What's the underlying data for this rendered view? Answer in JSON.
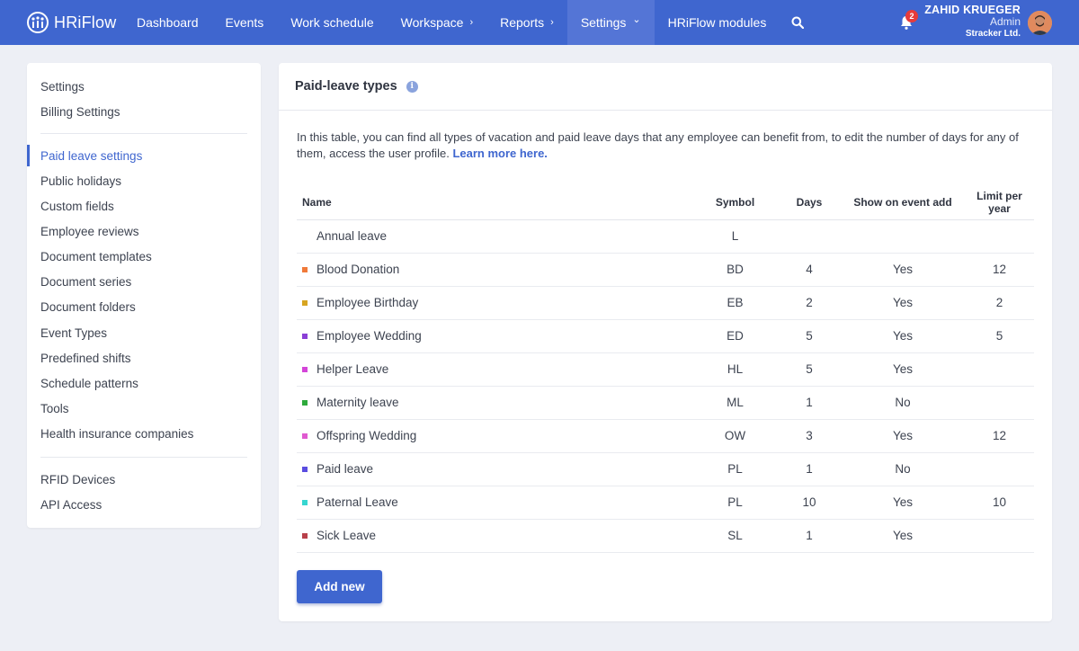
{
  "header": {
    "logo_text": "HRiFlow",
    "nav": [
      {
        "label": "Dashboard",
        "chevron": ""
      },
      {
        "label": "Events",
        "chevron": ""
      },
      {
        "label": "Work schedule",
        "chevron": ""
      },
      {
        "label": "Workspace",
        "chevron": "›"
      },
      {
        "label": "Reports",
        "chevron": "›"
      },
      {
        "label": "Settings",
        "chevron": "⌄"
      },
      {
        "label": "HRiFlow modules",
        "chevron": ""
      }
    ],
    "active_nav": "Settings",
    "notification_count": "2",
    "user": {
      "name": "ZAHID KRUEGER",
      "role": "Admin",
      "company": "Stracker Ltd."
    },
    "accent_color": "#3f66cf"
  },
  "sidebar": {
    "groups": [
      [
        "Settings",
        "Billing Settings"
      ],
      [
        "Paid leave settings",
        "Public holidays",
        "Custom fields",
        "Employee reviews",
        "Document templates",
        "Document series",
        "Document folders",
        "Event Types",
        "Predefined shifts",
        "Schedule patterns",
        "Tools",
        "Health insurance companies"
      ],
      [
        "RFID Devices",
        "API Access"
      ]
    ],
    "active": "Paid leave settings"
  },
  "main": {
    "title": "Paid-leave types",
    "intro_text": "In this table, you can find all types of vacation and paid leave days that any employee can benefit from, to edit the number of days for any of them, access the user profile.",
    "intro_link": "Learn more here.",
    "table": {
      "columns": [
        "Name",
        "Symbol",
        "Days",
        "Show on event add",
        "Limit per year"
      ],
      "rows": [
        {
          "name": "Annual leave",
          "color": "",
          "symbol": "L",
          "days": "",
          "show": "",
          "limit": ""
        },
        {
          "name": "Blood Donation",
          "color": "#f07a3a",
          "symbol": "BD",
          "days": "4",
          "show": "Yes",
          "limit": "12"
        },
        {
          "name": "Employee Birthday",
          "color": "#d7a521",
          "symbol": "EB",
          "days": "2",
          "show": "Yes",
          "limit": "2"
        },
        {
          "name": "Employee Wedding",
          "color": "#8a3fd6",
          "symbol": "ED",
          "days": "5",
          "show": "Yes",
          "limit": "5"
        },
        {
          "name": "Helper Leave",
          "color": "#d445d8",
          "symbol": "HL",
          "days": "5",
          "show": "Yes",
          "limit": ""
        },
        {
          "name": "Maternity leave",
          "color": "#2eaa3c",
          "symbol": "ML",
          "days": "1",
          "show": "No",
          "limit": ""
        },
        {
          "name": "Offspring Wedding",
          "color": "#e05ad0",
          "symbol": "OW",
          "days": "3",
          "show": "Yes",
          "limit": "12"
        },
        {
          "name": "Paid leave",
          "color": "#5a4de0",
          "symbol": "PL",
          "days": "1",
          "show": "No",
          "limit": ""
        },
        {
          "name": "Paternal Leave",
          "color": "#36d6d0",
          "symbol": "PL",
          "days": "10",
          "show": "Yes",
          "limit": "10"
        },
        {
          "name": "Sick Leave",
          "color": "#b8404a",
          "symbol": "SL",
          "days": "1",
          "show": "Yes",
          "limit": ""
        }
      ]
    },
    "add_button": "Add new"
  }
}
